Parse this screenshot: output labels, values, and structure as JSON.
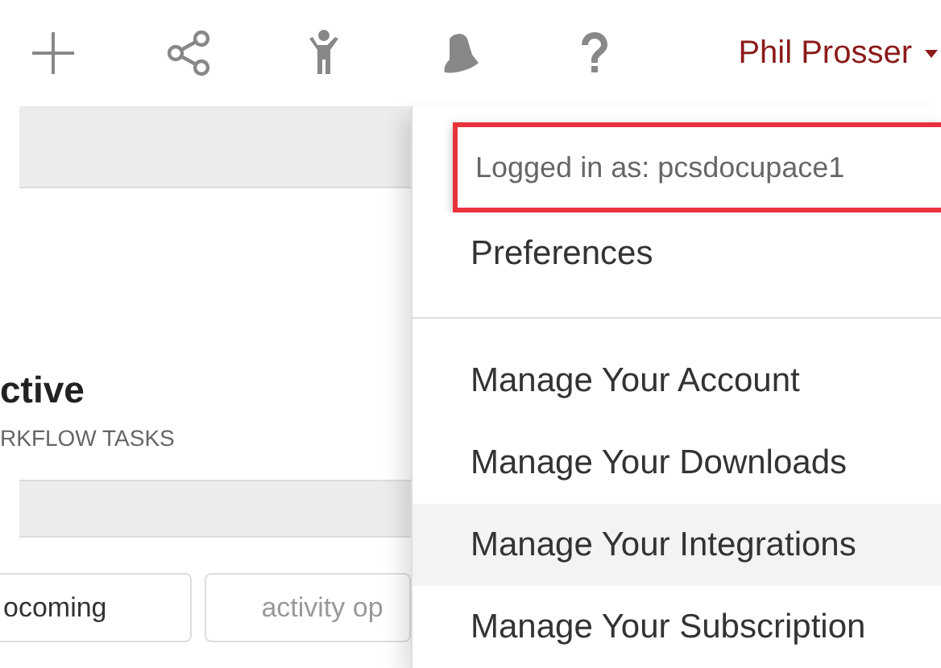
{
  "toolbar": {
    "icons": [
      {
        "kind": "plus"
      },
      {
        "kind": "share"
      },
      {
        "kind": "person"
      },
      {
        "kind": "bell"
      },
      {
        "kind": "help"
      }
    ],
    "user_name": "Phil Prosser"
  },
  "background": {
    "heading": "ctive",
    "subheading": "RKFLOW TASKS",
    "buttons": [
      {
        "label": "ocoming",
        "kind": "text"
      },
      {
        "label": "activity op",
        "kind": "hint"
      }
    ]
  },
  "user_menu": {
    "items": [
      {
        "label": "Logged in as: pcsdocupace1",
        "kind": "info",
        "highlighted": true,
        "hovered": false
      },
      {
        "label": "Preferences",
        "kind": "link",
        "highlighted": false,
        "hovered": false
      },
      {
        "kind": "divider"
      },
      {
        "label": "Manage Your Account",
        "kind": "link",
        "highlighted": false,
        "hovered": false
      },
      {
        "label": "Manage Your Downloads",
        "kind": "link",
        "highlighted": false,
        "hovered": false
      },
      {
        "label": "Manage Your Integrations",
        "kind": "link",
        "highlighted": false,
        "hovered": true
      },
      {
        "label": "Manage Your Subscription",
        "kind": "link",
        "highlighted": false,
        "hovered": false
      }
    ]
  }
}
